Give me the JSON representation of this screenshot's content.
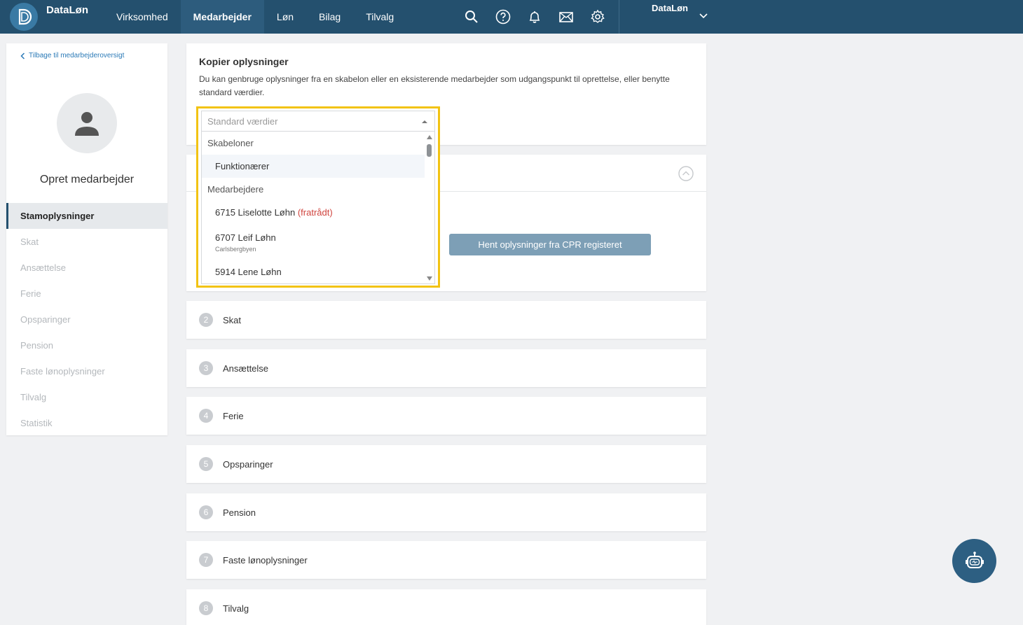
{
  "header": {
    "brand": "DataLøn",
    "nav": [
      {
        "label": "Virksomhed",
        "active": false
      },
      {
        "label": "Medarbejder",
        "active": true
      },
      {
        "label": "Løn",
        "active": false
      },
      {
        "label": "Bilag",
        "active": false
      },
      {
        "label": "Tilvalg",
        "active": false
      }
    ],
    "icons": [
      "search-icon",
      "help-icon",
      "bell-icon",
      "mail-icon",
      "gear-icon"
    ],
    "account": "DataLøn"
  },
  "sidebar": {
    "back_link": "Tilbage til medarbejderoversigt",
    "title": "Opret medarbejder",
    "items": [
      {
        "label": "Stamoplysninger",
        "active": true
      },
      {
        "label": "Skat",
        "active": false
      },
      {
        "label": "Ansættelse",
        "active": false
      },
      {
        "label": "Ferie",
        "active": false
      },
      {
        "label": "Opsparinger",
        "active": false
      },
      {
        "label": "Pension",
        "active": false
      },
      {
        "label": "Faste lønoplysninger",
        "active": false
      },
      {
        "label": "Tilvalg",
        "active": false
      },
      {
        "label": "Statistik",
        "active": false
      }
    ]
  },
  "kopier": {
    "title": "Kopier oplysninger",
    "description": "Du kan genbruge oplysninger fra en skabelon eller en eksisterende medarbejder som udgangspunkt til oprettelse, eller benytte standard værdier."
  },
  "dropdown": {
    "placeholder": "Standard værdier",
    "group_templates": "Skabeloner",
    "template_option": "Funktionærer",
    "group_employees": "Medarbejdere",
    "employees": [
      {
        "name": "6715 Liselotte Løhn",
        "status": "(fratrådt)",
        "sub": ""
      },
      {
        "name": "6707 Leif Løhn",
        "status": "",
        "sub": "Carlsbergbyen"
      },
      {
        "name": "5914 Lene Løhn",
        "status": "",
        "sub": ""
      }
    ]
  },
  "stam": {
    "cpr_button": "Hent oplysninger fra CPR registeret"
  },
  "sections": [
    {
      "number": "2",
      "label": "Skat"
    },
    {
      "number": "3",
      "label": "Ansættelse"
    },
    {
      "number": "4",
      "label": "Ferie"
    },
    {
      "number": "5",
      "label": "Opsparinger"
    },
    {
      "number": "6",
      "label": "Pension"
    },
    {
      "number": "7",
      "label": "Faste lønoplysninger"
    },
    {
      "number": "8",
      "label": "Tilvalg"
    }
  ],
  "colors": {
    "topbar": "#24506e",
    "highlight": "#f2c313",
    "link": "#2b7ab7",
    "button": "#7d9fb6",
    "fratraadt": "#d0443e"
  }
}
